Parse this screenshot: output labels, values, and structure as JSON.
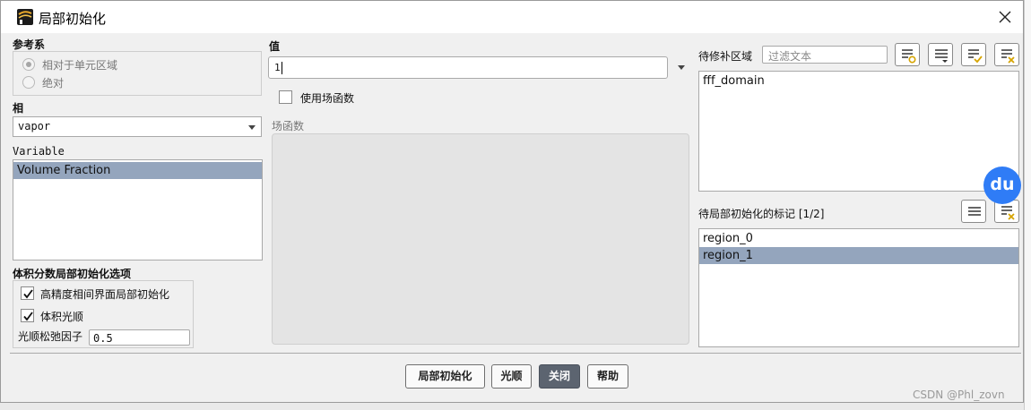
{
  "window": {
    "title": "局部初始化"
  },
  "reference_frame": {
    "label": "参考系",
    "options": [
      {
        "label": "相对于单元区域",
        "checked": true
      },
      {
        "label": "绝对",
        "checked": false
      }
    ]
  },
  "phase": {
    "label": "相",
    "selected": "vapor"
  },
  "variable": {
    "label": "Variable",
    "items": [
      "Volume Fraction"
    ],
    "selected_index": 0
  },
  "vof_options": {
    "label": "体积分数局部初始化选项",
    "high_res_label": "高精度相间界面局部初始化",
    "high_res_checked": true,
    "smooth_label": "体积光顺",
    "smooth_checked": true,
    "relax_label": "光顺松弛因子",
    "relax_value": "0.5"
  },
  "value": {
    "label": "值",
    "current": "1"
  },
  "field_function": {
    "checkbox_label": "使用场函数",
    "checked": false,
    "list_label": "场函数"
  },
  "zones": {
    "label": "待修补区域",
    "filter_placeholder": "过滤文本",
    "items": [
      "fff_domain"
    ]
  },
  "registers": {
    "label": "待局部初始化的标记 [1/2]",
    "items": [
      "region_0",
      "region_1"
    ],
    "selected_index": 1
  },
  "buttons": {
    "patch": "局部初始化",
    "smooth": "光顺",
    "close": "关闭",
    "help": "帮助"
  },
  "overlay": {
    "badge": "du",
    "watermark": "CSDN @Phl_zovn"
  },
  "icons": [
    "app-logo-icon",
    "close-icon",
    "chevron-down-icon",
    "checkmark-icon",
    "select-all-icon",
    "toggle-list-icon",
    "select-checked-icon",
    "deselect-all-icon"
  ],
  "colors": {
    "selection": "#94a5bd",
    "primary_button": "#5c6470",
    "badge": "#2f7cf6"
  }
}
